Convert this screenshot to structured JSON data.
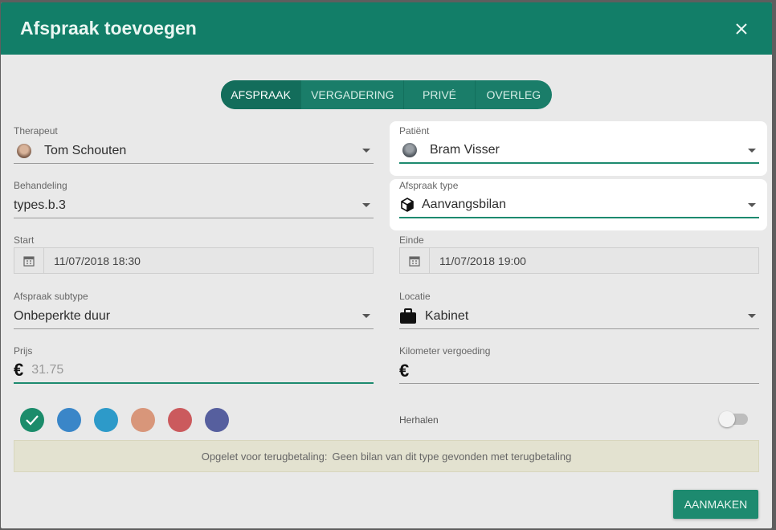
{
  "dialog": {
    "title": "Afspraak toevoegen",
    "close_icon": "close-icon"
  },
  "tabs": [
    "AFSPRAAK",
    "VERGADERING",
    "PRIVÉ",
    "OVERLEG"
  ],
  "fields": {
    "therapeut": {
      "label": "Therapeut",
      "value": "Tom Schouten"
    },
    "patient": {
      "label": "Patiënt",
      "value": "Bram Visser"
    },
    "behandeling": {
      "label": "Behandeling",
      "value": "types.b.3"
    },
    "afspraak_type": {
      "label": "Afspraak type",
      "value": "Aanvangsbilan",
      "icon": "cube-icon"
    },
    "start": {
      "label": "Start",
      "value": "11/07/2018 18:30",
      "icon": "calendar-icon"
    },
    "einde": {
      "label": "Einde",
      "value": "11/07/2018 19:00",
      "icon": "calendar-icon"
    },
    "subtype": {
      "label": "Afspraak subtype",
      "value": "Onbeperkte duur"
    },
    "locatie": {
      "label": "Locatie",
      "value": "Kabinet",
      "icon": "briefcase-icon"
    },
    "prijs": {
      "label": "Prijs",
      "placeholder": "31.75",
      "icon": "euro-icon"
    },
    "kilometer": {
      "label": "Kilometer vergoeding",
      "value": "",
      "icon": "euro-icon"
    }
  },
  "colors": {
    "selected": "#1b8c6b",
    "swatches": [
      "#1b8c6b",
      "#3a86c8",
      "#2d9ac9",
      "#d8967a",
      "#cb5a5d",
      "#565f9e"
    ]
  },
  "herhalen": {
    "label": "Herhalen",
    "enabled": false
  },
  "warning": {
    "prefix": "Opgelet voor terugbetaling:",
    "message": "Geen bilan van dit type gevonden met terugbetaling"
  },
  "actions": {
    "create_label": "AANMAKEN"
  },
  "accent": "#127e68"
}
